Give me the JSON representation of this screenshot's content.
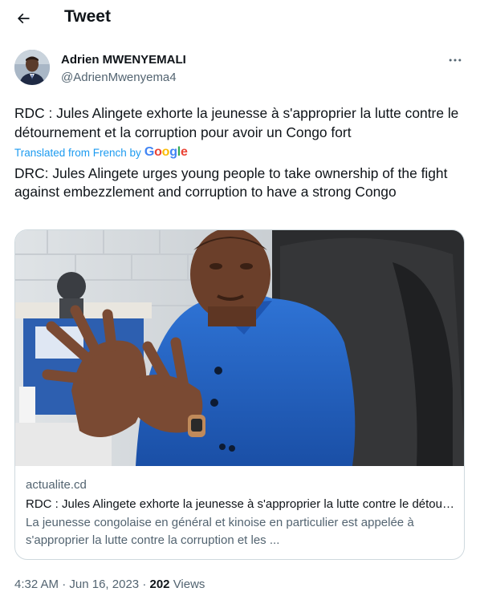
{
  "header": {
    "title": "Tweet",
    "back_icon": "arrow-left-icon"
  },
  "author": {
    "name": "Adrien MWENYEMALI",
    "handle": "@AdrienMwenyema4",
    "more_icon": "more-horizontal-icon"
  },
  "tweet": {
    "original_text": "RDC : Jules Alingete exhorte la jeunesse à s'approprier la lutte contre le détournement et la corruption pour avoir un Congo fort",
    "translated_label": "Translated from French by",
    "translator": "Google",
    "translated_text": "DRC: Jules Alingete urges young people to take ownership of the fight against embezzlement and corruption to have a strong Congo"
  },
  "link_card": {
    "domain": "actualite.cd",
    "title": "RDC : Jules Alingete exhorte la jeunesse à s'approprier la lutte contre le détournement et la corruption pour avoir un Congo fort",
    "description": "La jeunesse congolaise en général et kinoise en particulier est appelée à s'approprier la lutte contre la corruption et les ..."
  },
  "meta": {
    "time": "4:32 AM",
    "separator": "·",
    "date": "Jun 16, 2023",
    "views_count": "202",
    "views_label": "Views"
  },
  "colors": {
    "text": "#0f1419",
    "secondary": "#536471",
    "link": "#1d9bf0",
    "border": "#cfd9de",
    "suit_blue": "#1f5fc4"
  }
}
